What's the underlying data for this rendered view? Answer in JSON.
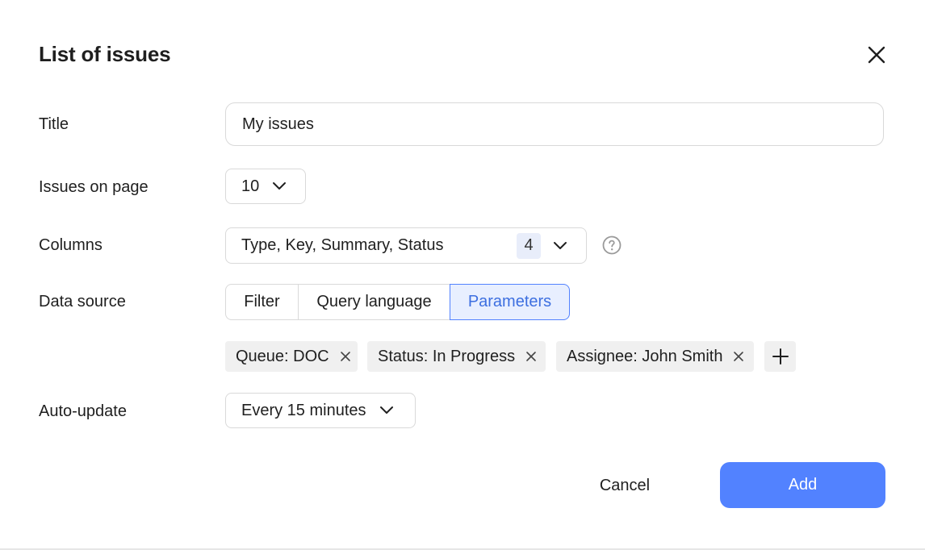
{
  "dialog": {
    "title": "List of issues",
    "close_icon": "close-icon"
  },
  "form": {
    "title_label": "Title",
    "title_value": "My issues",
    "issues_on_page_label": "Issues on page",
    "issues_on_page_value": "10",
    "columns_label": "Columns",
    "columns_value": "Type, Key, Summary, Status",
    "columns_count": "4",
    "columns_help_icon": "question-circle-icon",
    "data_source_label": "Data source",
    "data_source_tabs": [
      "Filter",
      "Query language",
      "Parameters"
    ],
    "data_source_selected": "Parameters",
    "parameters": [
      "Queue: DOC",
      "Status: In Progress",
      "Assignee: John Smith"
    ],
    "auto_update_label": "Auto-update",
    "auto_update_value": "Every 15 minutes"
  },
  "actions": {
    "cancel_label": "Cancel",
    "add_label": "Add"
  },
  "colors": {
    "accent": "#5282ff",
    "selected_tab_bg": "#e8efff",
    "selected_tab_text": "#3d6fe0",
    "chip_bg": "#f0f0f0",
    "border": "#d9d9d9"
  }
}
